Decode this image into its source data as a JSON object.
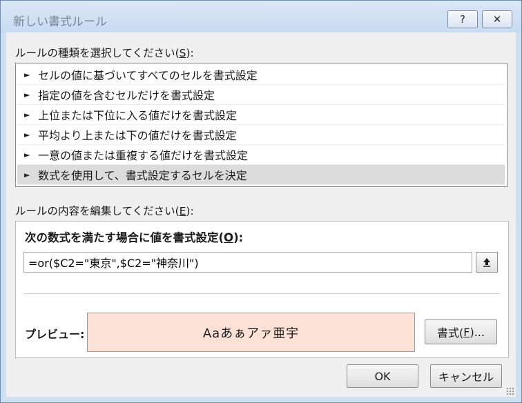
{
  "window": {
    "title": "新しい書式ルール",
    "help_label": "?",
    "close_label": "✕"
  },
  "rule_type": {
    "label_prefix": "ルールの種類を選択してください(",
    "label_key": "S",
    "label_suffix": "):",
    "arrow": "►",
    "items": [
      {
        "label": "セルの値に基づいてすべてのセルを書式設定"
      },
      {
        "label": "指定の値を含むセルだけを書式設定"
      },
      {
        "label": "上位または下位に入る値だけを書式設定"
      },
      {
        "label": "平均より上または下の値だけを書式設定"
      },
      {
        "label": "一意の値または重複する値だけを書式設定"
      },
      {
        "label": "数式を使用して、書式設定するセルを決定"
      }
    ],
    "selected_index": 5
  },
  "rule_edit": {
    "label_prefix": "ルールの内容を編集してください(",
    "label_key": "E",
    "label_suffix": "):",
    "formula_label_prefix": "次の数式を満たす場合に値を書式設定(",
    "formula_label_key": "O",
    "formula_label_suffix": "):",
    "formula_value": "=or($C2=\"東京\",$C2=\"神奈川\")",
    "preview_label": "プレビュー:",
    "preview_text": "Aaあぁアァ亜宇",
    "preview_bg": "#fbe1d6",
    "format_button_prefix": "書式(",
    "format_button_key": "F",
    "format_button_suffix": ")..."
  },
  "buttons": {
    "ok": "OK",
    "cancel": "キャンセル"
  }
}
